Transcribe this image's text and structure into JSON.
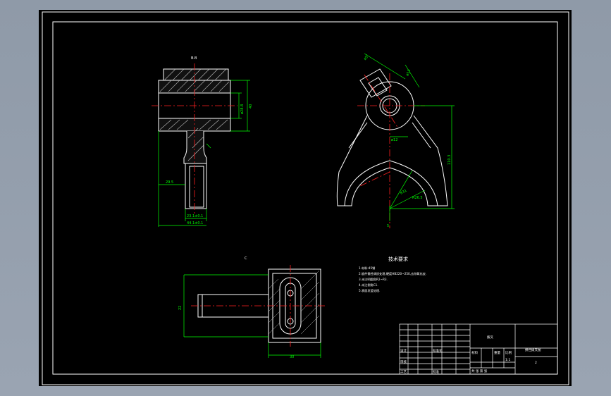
{
  "drawing": {
    "colors": {
      "background": "#000000",
      "frame": "#ffffff",
      "outline": "#ffffff",
      "centerline": "#ff2020",
      "dimension": "#00ff00",
      "hatch": "#ffffff"
    },
    "top_view_label": "B-B",
    "bottom_view_label": "C",
    "dimensions": {
      "front_height_a": "40",
      "front_height_b": "ø28.8",
      "front_stem": "29.5",
      "front_width_a": "23.1±0.1",
      "front_width_b": "44.1±0.1",
      "side_top_angle": "45°",
      "side_boss": "ø13",
      "side_hole": "ø12",
      "side_height": "110.3",
      "side_radius": "R31",
      "side_arc": "R26.5",
      "side_center": "5",
      "side_bottom": "B",
      "plan_left": "22",
      "plan_width": "30"
    },
    "tech_requirements": {
      "title": "技术要求",
      "lines": [
        "1.材料:45钢",
        "2.锻件需经调质处理,硬度HB220~250,去除氧化皮.",
        "3.未注明圆角R2~R3.",
        "4.未注倒角C1.",
        "5.表面发蓝处理."
      ]
    },
    "title_block": {
      "part_name": "拨叉",
      "drawing_title": "换挡拨叉图",
      "drawing_no": "2",
      "scale": "1:1",
      "designer_label": "设计",
      "checker_label": "审核",
      "process_label": "工艺",
      "approve_label": "批准",
      "material_label": "材料",
      "weight_label": "重量",
      "scale_label": "比例",
      "sheet_label": "共 张 第 张",
      "std_label": "标准化"
    }
  }
}
